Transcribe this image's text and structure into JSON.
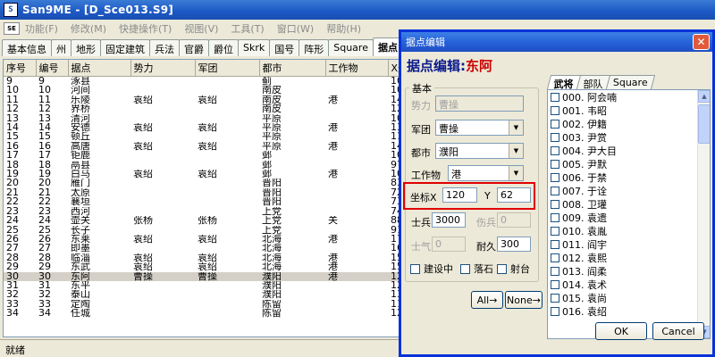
{
  "app": {
    "title": "San9ME - [D_Sce013.S9]"
  },
  "menu": [
    "功能(F)",
    "修改(M)",
    "快捷操作(T)",
    "视图(V)",
    "工具(T)",
    "窗口(W)",
    "帮助(H)"
  ],
  "tabs": [
    "基本信息",
    "州",
    "地形",
    "固定建筑",
    "兵法",
    "官爵",
    "爵位",
    "Skrk",
    "国号",
    "阵形",
    "Square",
    "据点"
  ],
  "grid": {
    "columns": [
      "序号",
      "编号",
      "据点",
      "势力",
      "军团",
      "都市",
      "工作物",
      "X坐"
    ],
    "rows": [
      [
        "9",
        "9",
        "涿县",
        "",
        "",
        "蓟",
        "",
        "10"
      ],
      [
        "10",
        "10",
        "河间",
        "",
        "",
        "南皮",
        "",
        "10"
      ],
      [
        "11",
        "11",
        "乐陵",
        "袁绍",
        "袁绍",
        "南皮",
        "港",
        "14"
      ],
      [
        "12",
        "12",
        "界桥",
        "",
        "",
        "南皮",
        "",
        "12"
      ],
      [
        "13",
        "13",
        "清河",
        "",
        "",
        "平原",
        "",
        "10"
      ],
      [
        "14",
        "14",
        "安德",
        "袁绍",
        "袁绍",
        "平原",
        "港",
        "13"
      ],
      [
        "15",
        "15",
        "顿丘",
        "",
        "",
        "平原",
        "",
        "11"
      ],
      [
        "16",
        "16",
        "高唐",
        "袁绍",
        "袁绍",
        "平原",
        "港",
        "14"
      ],
      [
        "17",
        "17",
        "钜鹿",
        "",
        "",
        "邺",
        "",
        "10"
      ],
      [
        "18",
        "18",
        "鬲县",
        "",
        "",
        "邺",
        "",
        "97"
      ],
      [
        "19",
        "19",
        "白马",
        "袁绍",
        "袁绍",
        "邺",
        "港",
        "10"
      ],
      [
        "20",
        "20",
        "雁门",
        "",
        "",
        "晋阳",
        "",
        "83"
      ],
      [
        "21",
        "21",
        "太原",
        "",
        "",
        "晋阳",
        "",
        "72"
      ],
      [
        "22",
        "22",
        "襄垣",
        "",
        "",
        "晋阳",
        "",
        "73"
      ],
      [
        "23",
        "23",
        "西河",
        "",
        "",
        "上党",
        "",
        "74"
      ],
      [
        "24",
        "24",
        "壶关",
        "张杨",
        "张杨",
        "上党",
        "关",
        "88"
      ],
      [
        "25",
        "25",
        "长子",
        "",
        "",
        "上党",
        "",
        "91"
      ],
      [
        "26",
        "26",
        "东莱",
        "袁绍",
        "袁绍",
        "北海",
        "港",
        "17"
      ],
      [
        "27",
        "27",
        "即墨",
        "",
        "",
        "北海",
        "",
        "16"
      ],
      [
        "28",
        "28",
        "临淄",
        "袁绍",
        "袁绍",
        "北海",
        "港",
        "15"
      ],
      [
        "29",
        "29",
        "东武",
        "袁绍",
        "袁绍",
        "北海",
        "港",
        "15"
      ],
      [
        "30",
        "30",
        "东阿",
        "曹操",
        "曹操",
        "濮阳",
        "港",
        "12"
      ],
      [
        "31",
        "31",
        "东平",
        "",
        "",
        "濮阳",
        "",
        "12"
      ],
      [
        "32",
        "32",
        "泰山",
        "",
        "",
        "濮阳",
        "",
        "13"
      ],
      [
        "33",
        "33",
        "定陶",
        "",
        "",
        "陈留",
        "",
        "11"
      ],
      [
        "34",
        "34",
        "任城",
        "",
        "",
        "陈留",
        "",
        "12"
      ]
    ],
    "selected_row": 21
  },
  "status": "就绪",
  "dialog": {
    "title": "据点编辑",
    "heading_prefix": "据点编辑:",
    "heading_name": "东阿",
    "group_basic": "基本",
    "force_label": "势力",
    "force_value": "曹操",
    "corps_label": "军团",
    "corps_value": "曹操",
    "city_label": "都市",
    "city_value": "濮阳",
    "work_label": "工作物",
    "work_value": "港",
    "coord_label": "坐标X",
    "x_value": "120",
    "y_label": "Y",
    "y_value": "62",
    "soldiers_label": "士兵",
    "soldiers_value": "3000",
    "wounded_label": "伤兵",
    "wounded_value": "0",
    "morale_label": "士气",
    "morale_value": "0",
    "durability_label": "耐久",
    "durability_value": "300",
    "cb_building": "建设中",
    "cb_fallen": "落石",
    "cb_ballista": "射台",
    "all_button": "All→",
    "none_button": "None→",
    "ok_button": "OK",
    "cancel_button": "Cancel",
    "right_tabs": [
      "武将",
      "部队",
      "Square"
    ],
    "officers": [
      "000. 阿会喃",
      "001. 韦昭",
      "002. 伊籍",
      "003. 尹赏",
      "004. 尹大目",
      "005. 尹默",
      "006. 于禁",
      "007. 于诠",
      "008. 卫瓘",
      "009. 袁遗",
      "010. 袁胤",
      "011. 阎宇",
      "012. 袁熙",
      "013. 阎柔",
      "014. 袁术",
      "015. 袁尚",
      "016. 袁绍"
    ]
  }
}
